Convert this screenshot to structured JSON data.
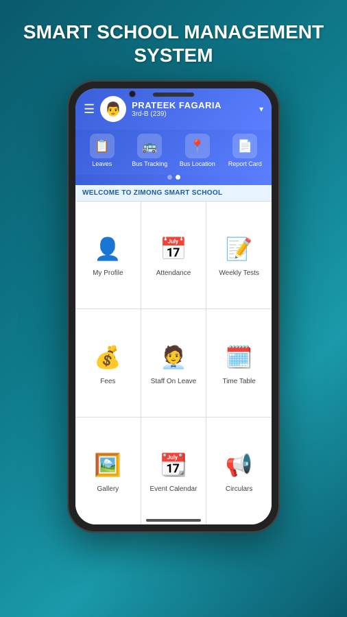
{
  "title": {
    "line1": "SMART SCHOOL MANAGEMENT",
    "line2": "SYSTEM"
  },
  "header": {
    "hamburger": "☰",
    "user_name": "PRATEEK FAGARIA",
    "user_class": "3rd-B (239)",
    "dropdown_arrow": "▾"
  },
  "nav_icons": [
    {
      "id": "leaves",
      "icon": "📋",
      "label": "Leaves"
    },
    {
      "id": "bus_tracking",
      "icon": "🚌",
      "label": "Bus Tracking"
    },
    {
      "id": "bus_location",
      "icon": "📍",
      "label": "Bus Location"
    },
    {
      "id": "report_card",
      "icon": "📄",
      "label": "Report Card"
    }
  ],
  "dots": [
    {
      "active": false
    },
    {
      "active": true
    }
  ],
  "welcome_text": "WELCOME TO ZIMONG SMART SCHOOL",
  "grid_items": [
    {
      "id": "my-profile",
      "icon": "👤",
      "label": "My Profile",
      "color": "icon-profile"
    },
    {
      "id": "attendance",
      "icon": "📅",
      "label": "Attendance",
      "color": "icon-attendance"
    },
    {
      "id": "weekly-tests",
      "icon": "📝",
      "label": "Weekly Tests",
      "color": "icon-weekly"
    },
    {
      "id": "fees",
      "icon": "💰",
      "label": "Fees",
      "color": "icon-fees"
    },
    {
      "id": "staff-on-leave",
      "icon": "🧑‍💼",
      "label": "Staff On Leave",
      "color": "icon-staffleave"
    },
    {
      "id": "time-table",
      "icon": "🗓️",
      "label": "Time Table",
      "color": "icon-timetable"
    },
    {
      "id": "gallery",
      "icon": "🖼️",
      "label": "Gallery",
      "color": "icon-gallery"
    },
    {
      "id": "event-calendar",
      "icon": "📆",
      "label": "Event Calendar",
      "color": "icon-eventcal"
    },
    {
      "id": "circulars",
      "icon": "📢",
      "label": "Circulars",
      "color": "icon-circulars"
    }
  ]
}
